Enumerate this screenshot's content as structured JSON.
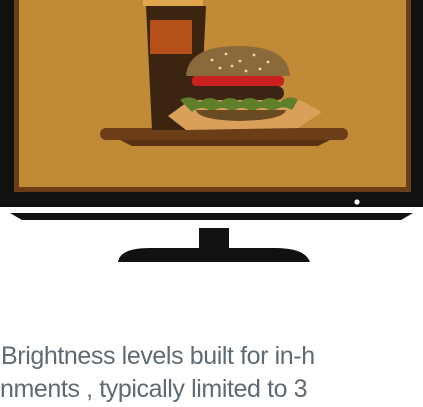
{
  "hero": {
    "illustration": "tv-showing-burger-and-drink-icon",
    "colors": {
      "bezel": "#111111",
      "screen": "#c08a37",
      "screen_frame": "#6b3e18",
      "indicator": "#ffffff"
    }
  },
  "caption": {
    "line1": "Brightness levels built for in-h",
    "line2": "nments , typically limited to 3"
  }
}
